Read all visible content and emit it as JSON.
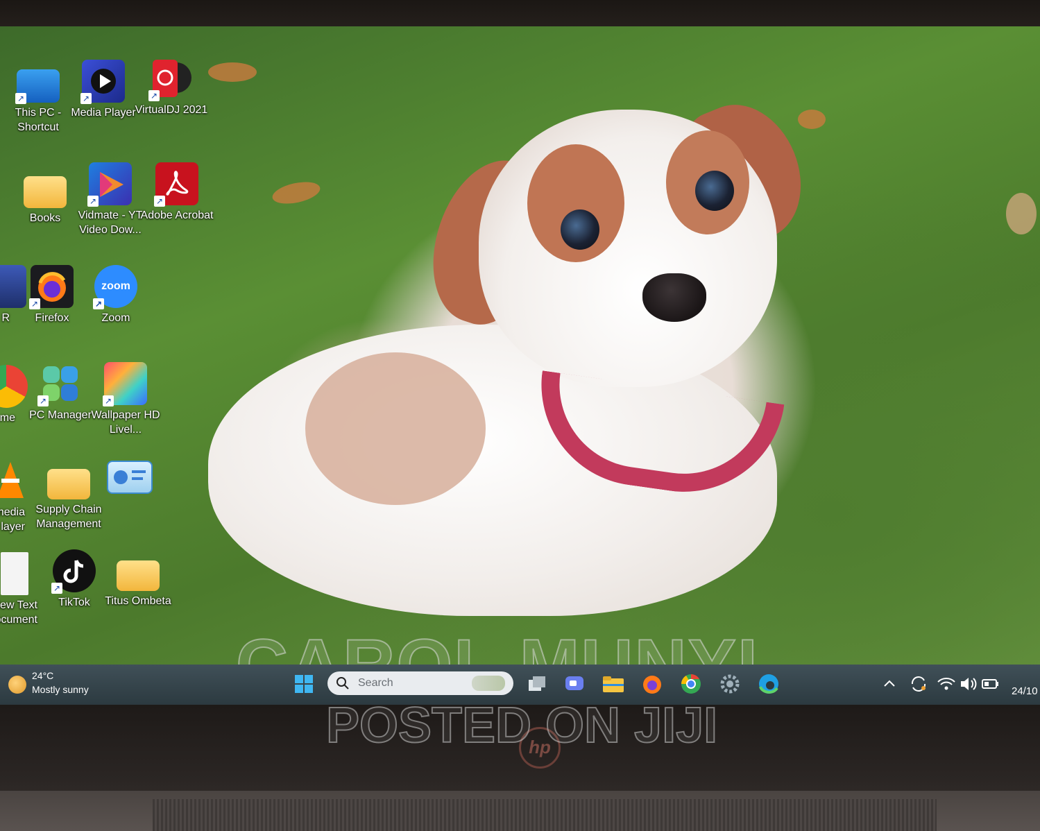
{
  "desktop": {
    "icons": [
      {
        "label": "This PC - Shortcut",
        "icon": "monitor-icon"
      },
      {
        "label": "Media Player",
        "icon": "media-player-icon"
      },
      {
        "label": "VirtualDJ 2021",
        "icon": "virtualdj-icon"
      },
      {
        "label": "Books",
        "icon": "folder-icon"
      },
      {
        "label": "Vidmate - YT Video Dow...",
        "icon": "vidmate-icon"
      },
      {
        "label": "Adobe Acrobat",
        "icon": "acrobat-icon"
      },
      {
        "label": "R",
        "icon": "app-icon"
      },
      {
        "label": "Firefox",
        "icon": "firefox-icon"
      },
      {
        "label": "Zoom",
        "icon": "zoom-icon"
      },
      {
        "label": "gle ome",
        "icon": "chrome-icon"
      },
      {
        "label": "PC Manager",
        "icon": "pc-manager-icon"
      },
      {
        "label": "Wallpaper HD Livel...",
        "icon": "wallpaper-icon"
      },
      {
        "label": "media layer",
        "icon": "vlc-icon"
      },
      {
        "label": "Supply Chain Management",
        "icon": "folder-icon"
      },
      {
        "label": "",
        "icon": "presentation-icon"
      },
      {
        "label": "lew Text ocument",
        "icon": "text-document-icon"
      },
      {
        "label": "TikTok",
        "icon": "tiktok-icon"
      },
      {
        "label": "Titus Ombeta",
        "icon": "folder-icon"
      }
    ],
    "zoom_glyph": "zoom"
  },
  "taskbar": {
    "weather_temp": "24°C",
    "weather_condition": "Mostly sunny",
    "search_placeholder": "Search",
    "date_partial": "24/10",
    "apps": [
      "start-icon",
      "task-view-icon",
      "chat-icon",
      "file-explorer-icon",
      "firefox-icon",
      "chrome-icon",
      "settings-icon",
      "edge-icon"
    ]
  },
  "watermark": {
    "line1": "CAROL MUNYI",
    "line2": "POSTED ON JIJI"
  },
  "hardware": {
    "logo": "hp"
  },
  "colors": {
    "taskbar": "#34444a",
    "grass": "#5a8f34",
    "collar": "#c23a5c",
    "ear": "#b5694a"
  }
}
